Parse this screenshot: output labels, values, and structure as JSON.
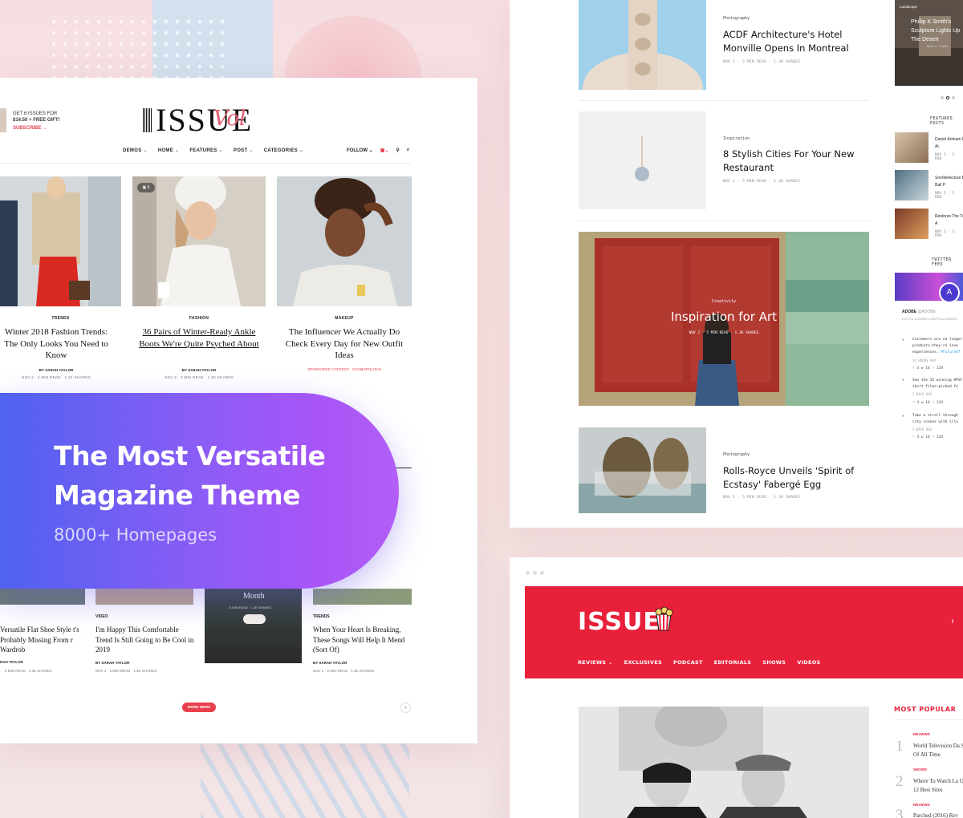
{
  "hero": {
    "title": "The Most Versatile Magazine Theme",
    "subtitle": "8000+ Homepages"
  },
  "left_demo": {
    "promo": {
      "line1": "GET 6 ISSUES FOR",
      "line2": "$14.50 + FREE GIFT!",
      "cta": "SUBSCRIBE →"
    },
    "logo": {
      "text": "ISSUE",
      "script": "Vol"
    },
    "nav": [
      "DEMOS",
      "HOME",
      "FEATURES",
      "POST",
      "CATEGORIES"
    ],
    "nav_right": {
      "follow": "FOLLOW"
    },
    "articles": [
      {
        "category": "TRENDS",
        "title": "Winter 2018 Fashion Trends: The Only Looks You Need to Know",
        "byline": "BY SARAH TAYLOR",
        "meta": "NOV 2  ·  5 MIN READ  ·  1.3K SHARES"
      },
      {
        "category": "FASHION",
        "title": "36 Pairs of Winter-Ready Ankle Boots We're Quite Psyched About",
        "byline": "BY SARAH TAYLOR",
        "meta": "NOV 2  ·  3 MIN READ  ·  1.3K SHARES",
        "image_count": "6"
      },
      {
        "category": "MAKEUP",
        "title": "The Influencer We Actually Do Check Every Day for New Outfit Ideas",
        "sponsor": "SPONSORED CONTENT  ·  COSMOPOLITAN"
      }
    ],
    "bottom_articles": [
      {
        "category": "",
        "title": "Versatile Flat Shoe Style t's Probably Missing From r Wardrob",
        "byline": "RAH TAYLOR",
        "meta": "5 MIN READ  ·  1.3K SHARES"
      },
      {
        "category": "VIDEO",
        "title": "I'm Happy This Comfortable Trend Is Still Going to Be Cool in 2019",
        "byline": "BY SARAH TAYLOR",
        "meta": "NOV 2  ·  5 MIN READ  ·  1.3K SHARES"
      },
      {
        "category": "",
        "title": "Month",
        "byline": "",
        "meta": "5 MIN READ  ·  1.3K SHARES"
      },
      {
        "category": "TRENDS",
        "title": "When Your Heart Is Breaking, These Songs Will Help It Mend (Sort Of)",
        "byline": "BY SARAH TAYLOR",
        "meta": "NOV 2  ·  5 MIN READ  ·  1.3K SHARES"
      }
    ],
    "social": [
      "f",
      "t",
      "◎"
    ],
    "more_news": "MORE NEWS",
    "next": "›"
  },
  "right_top_demo": {
    "articles": [
      {
        "category": "Photography",
        "title": "ACDF Architecture's Hotel Monville Opens In Montreal",
        "meta": "NOV 2  ·  5 MIN READ  ·  1.3K SHARES"
      },
      {
        "category": "Inspiration",
        "title": "8 Stylish Cities For Your New Restaurant",
        "meta": "NOV 2  ·  5 MIN READ  ·  1.3K SHARES"
      },
      {
        "category": "Photography",
        "title": "Rolls-Royce Unveils 'Spirit of Ecstasy' Fabergé Egg",
        "meta": "NOV 2  ·  5 MIN READ  ·  1.3K SHARES"
      }
    ],
    "featured": {
      "category": "Creativity",
      "title": "Inspiration for Art",
      "meta": "NOV 2  ·  5 MIN READ  ·  1.3K SHARES"
    },
    "sidebar": {
      "slider": {
        "category": "Landscape",
        "title": "Phillip K Smith's Sculpture Lights Up The Desert",
        "meta": "NOV 2  ·  5 MIN"
      },
      "featured_label": "FEATURED POSTS",
      "featured_posts": [
        {
          "title": "Daniel Arsham Exhibition At",
          "meta": "NOV 2  ·  5 MIN"
        },
        {
          "title": "Snorkletecture Bouncy Ball P",
          "meta": "NOV 2  ·  5 MIN"
        },
        {
          "title": "Restores The Tunnel With A",
          "meta": "NOV 2  ·  5 MIN"
        }
      ],
      "twitter_label": "TWITTER FEED",
      "twitter": {
        "handle": "ADOBE",
        "at": "@ADOBE",
        "stats": "213 FOLLOWING    4.5M FOLLOWERS",
        "tweets": [
          {
            "text": "Customers are no longer products—they're inve experiences.",
            "link": "#FutureOf",
            "time": "14 HOURS AGO",
            "acts": "♡ 4   ⇄ 18   ♡ 128"
          },
          {
            "text": "See the 15 winning #PSF short films—picked fo",
            "link": "",
            "time": "2 DAYS AGO",
            "acts": "♡ 4   ⇄ 18   ♡ 128"
          },
          {
            "text": "Take a stroll through city scenes with illu",
            "link": "",
            "time": "2 DAYS AGO",
            "acts": "♡ 4   ⇄ 18   ♡ 128"
          }
        ]
      }
    }
  },
  "right_bottom_demo": {
    "logo": "ISSUE",
    "nav": [
      "REVIEWS",
      "EXCLUSIVES",
      "PODCAST",
      "EDITORIALS",
      "SHOWS",
      "VIDEOS"
    ],
    "fb": "f",
    "most_popular_label": "MOST POPULAR",
    "most_popular": [
      {
        "num": "1",
        "category": "REVIEWS",
        "title": "World Television Da Shows Of All Time"
      },
      {
        "num": "2",
        "category": "SHOWS",
        "title": "Where To Watch La Online: 12 Best Sites"
      },
      {
        "num": "3",
        "category": "REVIEWS",
        "title": "Parched (2016) Rev"
      }
    ]
  },
  "colors": {
    "accent_red": "#e8203a",
    "gradient_start": "#4f62f0",
    "gradient_end": "#b25ef7"
  }
}
